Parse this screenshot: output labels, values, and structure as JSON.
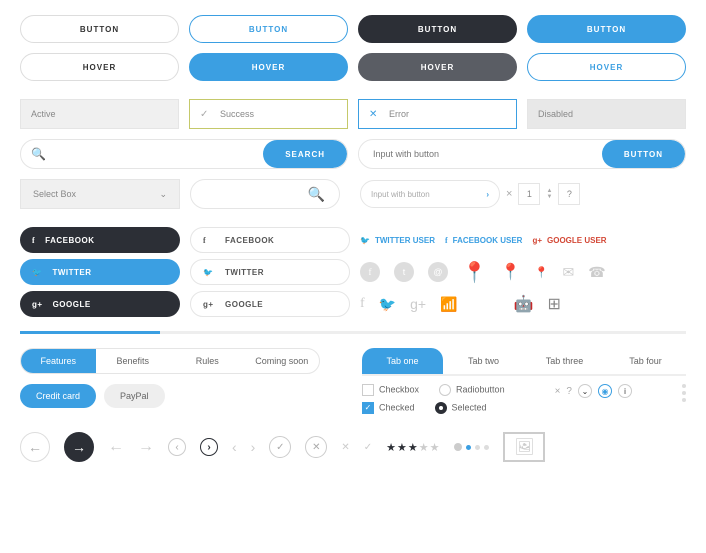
{
  "buttons": {
    "r1": [
      "BUTTON",
      "BUTTON",
      "BUTTON",
      "BUTTON"
    ],
    "r2": [
      "HOVER",
      "HOVER",
      "HOVER",
      "HOVER"
    ]
  },
  "inputs": {
    "active": "Active",
    "success": "Success",
    "error": "Error",
    "disabled": "Disabled",
    "search_btn": "SEARCH",
    "input_btn_ph": "Input with button",
    "input_btn_label": "BUTTON",
    "select": "Select Box",
    "mini_ph": "Input with button",
    "qty": "1",
    "qmark": "?",
    "xmark": "×"
  },
  "social": {
    "fb": "FACEBOOK",
    "tw": "TWITTER",
    "gg": "GOOGLE",
    "tw_user": "TWITTER USER",
    "fb_user": "FACEBOOK USER",
    "gg_user": "GOOGLE USER"
  },
  "tabs": {
    "pill": [
      "Features",
      "Benefits",
      "Rules",
      "Coming soon"
    ],
    "main": [
      "Tab one",
      "Tab two",
      "Tab three",
      "Tab four"
    ],
    "chips": [
      "Credit card",
      "PayPal"
    ]
  },
  "form": {
    "checkbox": "Checkbox",
    "radio": "Radiobutton",
    "checked": "Checked",
    "selected": "Selected"
  }
}
